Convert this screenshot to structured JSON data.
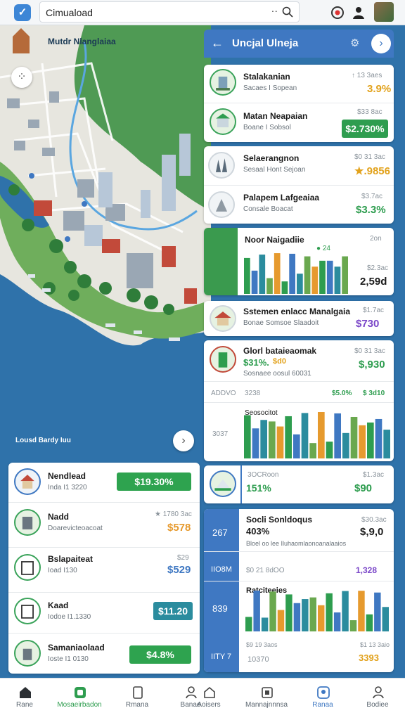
{
  "app": {
    "logo": "app-logo-icon",
    "search_text": "Cimuaload",
    "search_more": "··"
  },
  "map": {
    "city_label": "Mutdr Nlanglaiaa",
    "bay_label": "Lousd Bardy Iuu",
    "back_label": "‹",
    "next_label": "›"
  },
  "panel": {
    "title": "Uncjal Ulneja",
    "back": "←",
    "close": "›"
  },
  "right_list": [
    {
      "name": "Stalakanian",
      "sub": "Sacaes I Sopean",
      "small": "↑ 13 3aes",
      "value": "3.9%",
      "value_color": "#e2a21c"
    },
    {
      "name": "Matan Neapaian",
      "sub": "Boane I Sobsol",
      "small": "$33 8ac",
      "value": "$2.730%",
      "badge": true
    }
  ],
  "right_list2": [
    {
      "name": "Selaerangnon",
      "sub": "Sesaal Hont Sejoan",
      "small": "$0 31 3ac",
      "value": "★.9856",
      "value_color": "#e2a21c"
    },
    {
      "name": "Palapem Lafgeaiaa",
      "sub": "Consale Boacat",
      "small": "$3.7ac",
      "value": "$3.3%",
      "value_color": "#2e9d4f"
    }
  ],
  "chart1": {
    "title": "Noor Naigadiie",
    "legend": "● 24",
    "right_top": "2on",
    "right_mid": "$2.3ac",
    "right_value": "2,59d"
  },
  "mid_item": {
    "name": "Sstemen enlacc Manalgaia",
    "sub": "Bonae Somsoe Slaadoit",
    "small": "$1.7ac",
    "value": "$730",
    "value_color": "#7a46c8"
  },
  "card2": {
    "name": "Glorl bataieaomak",
    "pct": "$31%.",
    "pct2": "$d0",
    "small": "$0 31 3ac",
    "sub": "Sosnaee oosul 60031",
    "value": "$,930",
    "row2_left": "ADDVO",
    "row2_mid": "3238",
    "row2_pct": "$5.0%",
    "row2_val": "$ 3d10",
    "chart_title": "Seosocitot",
    "side_label": "3037"
  },
  "card3": {
    "name": "3OCRoon",
    "pct": "151%",
    "small": "$1.3ac",
    "value": "$90"
  },
  "card4": {
    "side_top": "267",
    "name": "Socli Sonldoqus",
    "pct": "403%",
    "small": "$30.3ac",
    "sub": "Bloel oo lee Iluhaomlaonoanalaaios",
    "value": "$,9,0",
    "side_mid": "IIO8M",
    "row2_left": "$0 21 8dOO",
    "row2_val": "1,328",
    "chart_title": "Ratciteeies",
    "side_bot": "839",
    "foot_left": "$9 19 3aos",
    "foot_small": "$1 13 3aio",
    "side_last": "IITY 7",
    "foot_mid": "10370",
    "foot_val": "3393"
  },
  "left_list": [
    {
      "name": "Nendlead",
      "sub": "Inda I1 3220",
      "value": "$19.30%",
      "badge_color": "#2ea34f"
    },
    {
      "name": "Nadd",
      "sub": "Doarevicteoacoat",
      "small": "★ 1780 3ac",
      "value": "$578",
      "value_color": "#e69a2e"
    },
    {
      "name": "Bslapaiteat",
      "sub": "Ioad I130",
      "small": "$29",
      "value": "$529",
      "value_color": "#3f78c2"
    },
    {
      "name": "Kaad",
      "sub": "Iodoe I1.1330",
      "value": "$11.20",
      "badge_color": "#2b8c9e"
    },
    {
      "name": "Samaniaolaad",
      "sub": "Ioste I1 0130",
      "value": "$4.8%",
      "badge_color": "#2ea34f"
    }
  ],
  "nav": [
    {
      "label": "Rane",
      "icon": "home-icon"
    },
    {
      "label": "Mosaeirbadon",
      "icon": "map-icon"
    },
    {
      "label": "Rmana",
      "icon": "document-icon"
    },
    {
      "label": "Banae",
      "icon": "person-icon"
    },
    {
      "label": "Aoisers",
      "icon": "home-outline-icon"
    },
    {
      "label": "Mannajnnnsa",
      "icon": "grid-icon"
    },
    {
      "label": "Ranaa",
      "icon": "pin-icon"
    },
    {
      "label": "Bodiee",
      "icon": "profile-icon"
    }
  ],
  "colors": {
    "green": "#2e9d4f",
    "blue": "#3f78c2",
    "teal": "#2b8c9e",
    "orange": "#e69a2e",
    "yellow": "#e2a21c",
    "water": "#2d6fa6"
  }
}
